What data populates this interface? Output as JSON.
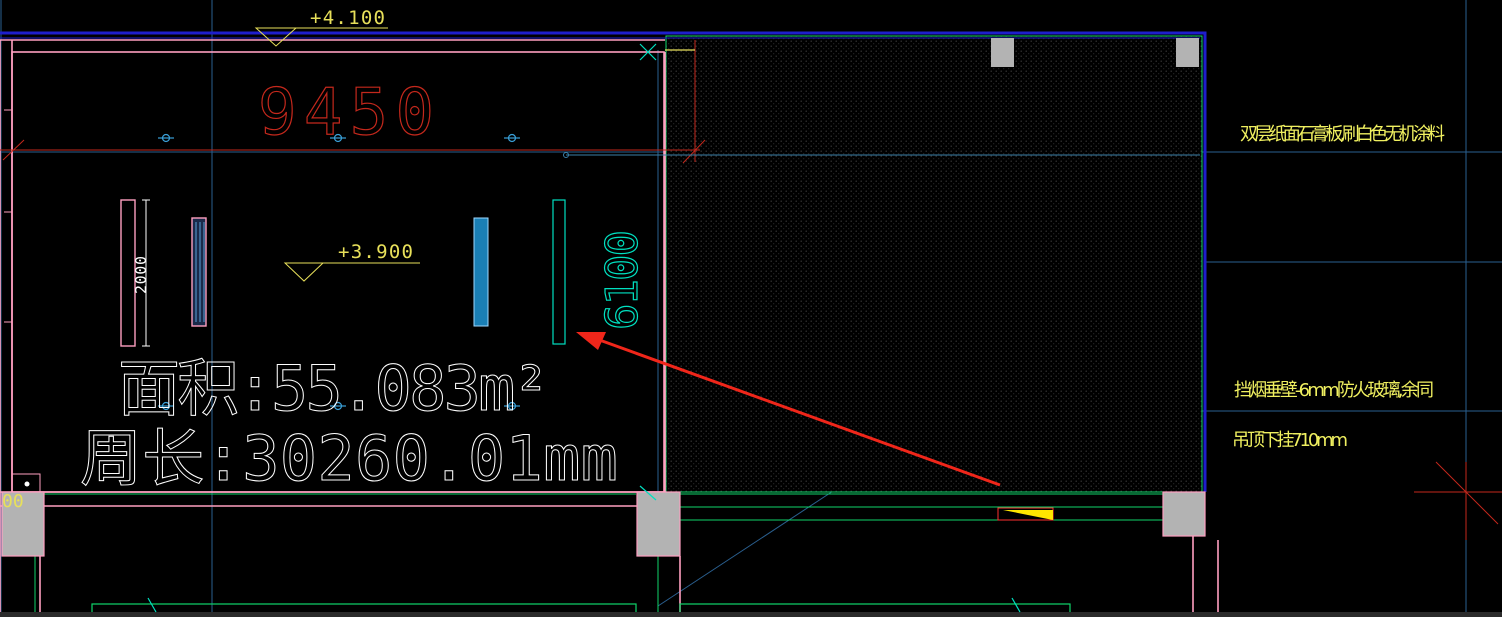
{
  "levels": {
    "top": "+4.100",
    "inner": "+3.900"
  },
  "dimensions": {
    "width": "9450",
    "height": "6100",
    "light_length": "2000",
    "corner_label": "00"
  },
  "room": {
    "area": "面积:55.083m²",
    "perimeter": "周长:30260.01mm"
  },
  "notes": {
    "ceiling": "双层纸面石膏板,刷白色无机涂料",
    "smoke_barrier": "挡烟垂壁-6mm防火玻璃,余同",
    "drop": "吊顶下挂710mm"
  },
  "colors": {
    "background": "#000000",
    "wall_pink": "#ff9fc0",
    "dimension_red": "#c4281c",
    "dimension_cyan": "#00e0c0",
    "guide_blue": "#2a5f8f",
    "boundary_blue": "#1e1ecc",
    "hatch_green": "#0fd46a",
    "note_yellow": "#f0f060",
    "level_yellow": "#e8e05a",
    "column_gray": "#b3b3b3",
    "arrow_red": "#f0261a",
    "fixture_blue": "#1a7fb5"
  }
}
